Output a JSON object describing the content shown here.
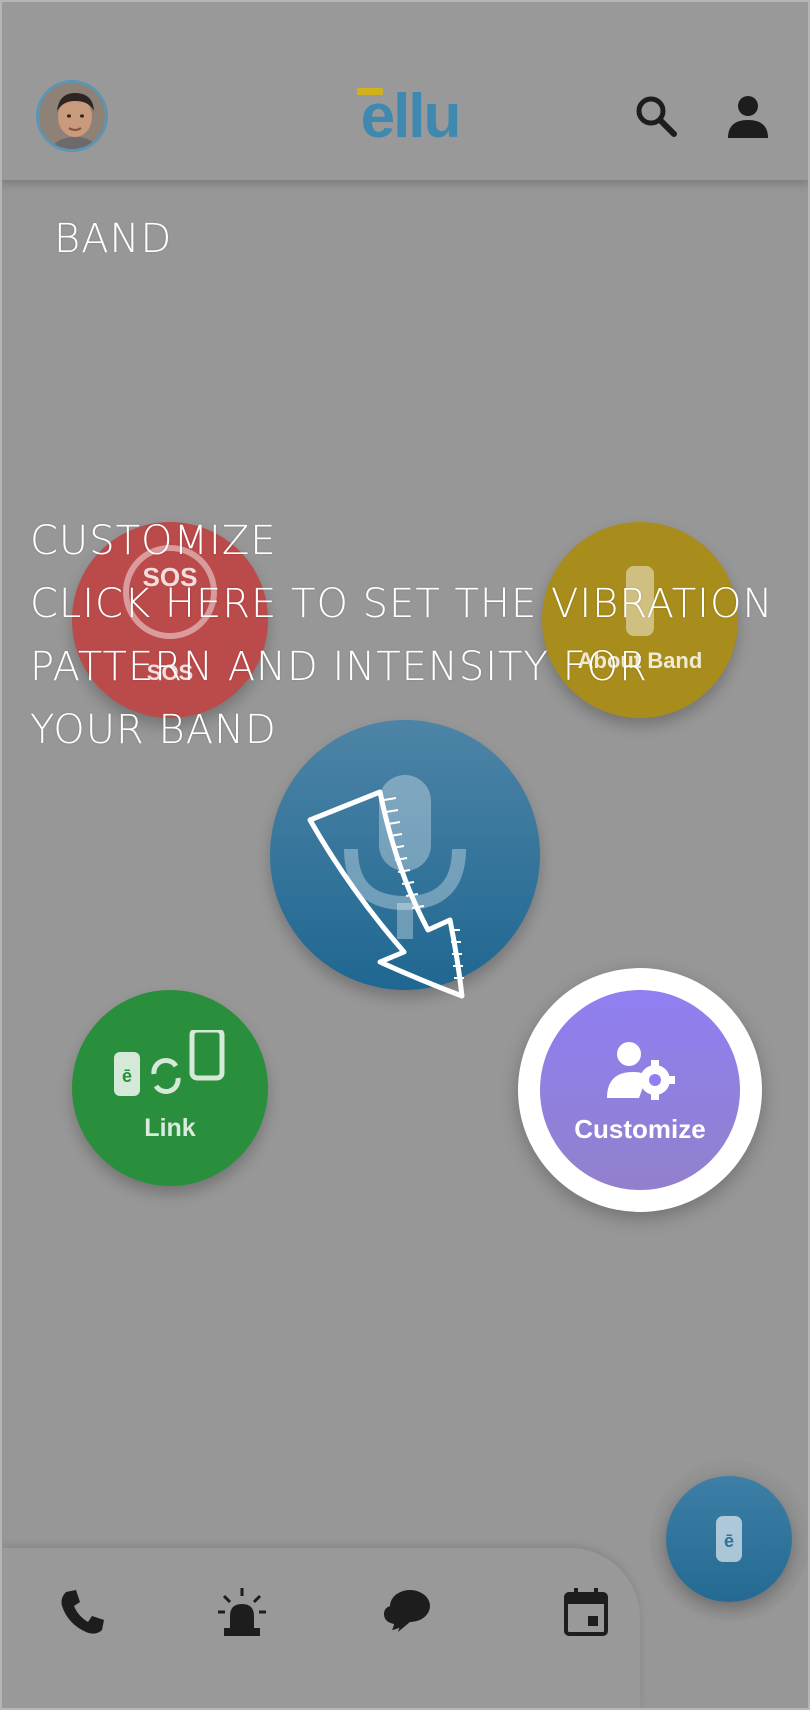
{
  "app": {
    "logo_text": "ellu",
    "brand_colors": {
      "logo_blue": "#3f88b0",
      "logo_bar": "#d3b11a"
    }
  },
  "header": {
    "avatar_icon": "user-avatar",
    "search_icon": "search-icon",
    "profile_icon": "person-icon"
  },
  "coach": {
    "top_label": "BAND",
    "title": "CUSTOMIZE",
    "line1": "CLICK HERE TO SET THE VIBRATION",
    "line2": "PATTERN AND INTENSITY FOR",
    "line3": "YOUR BAND"
  },
  "circles": {
    "sos": {
      "icon_text": "SOS",
      "label": "SOS",
      "color": "#bb4a4a"
    },
    "about": {
      "label": "About Band",
      "color": "#a88c1c"
    },
    "mic": {
      "color": "#2a6f99"
    },
    "link": {
      "label": "Link",
      "color": "#2a8f3c"
    },
    "customize": {
      "label": "Customize",
      "color": "#8f7ff2"
    }
  },
  "bottom_nav": {
    "items": [
      {
        "icon": "phone-icon"
      },
      {
        "icon": "alarm-light-icon"
      },
      {
        "icon": "chat-icon"
      },
      {
        "icon": "calendar-icon"
      }
    ],
    "fab_text": "ē"
  }
}
